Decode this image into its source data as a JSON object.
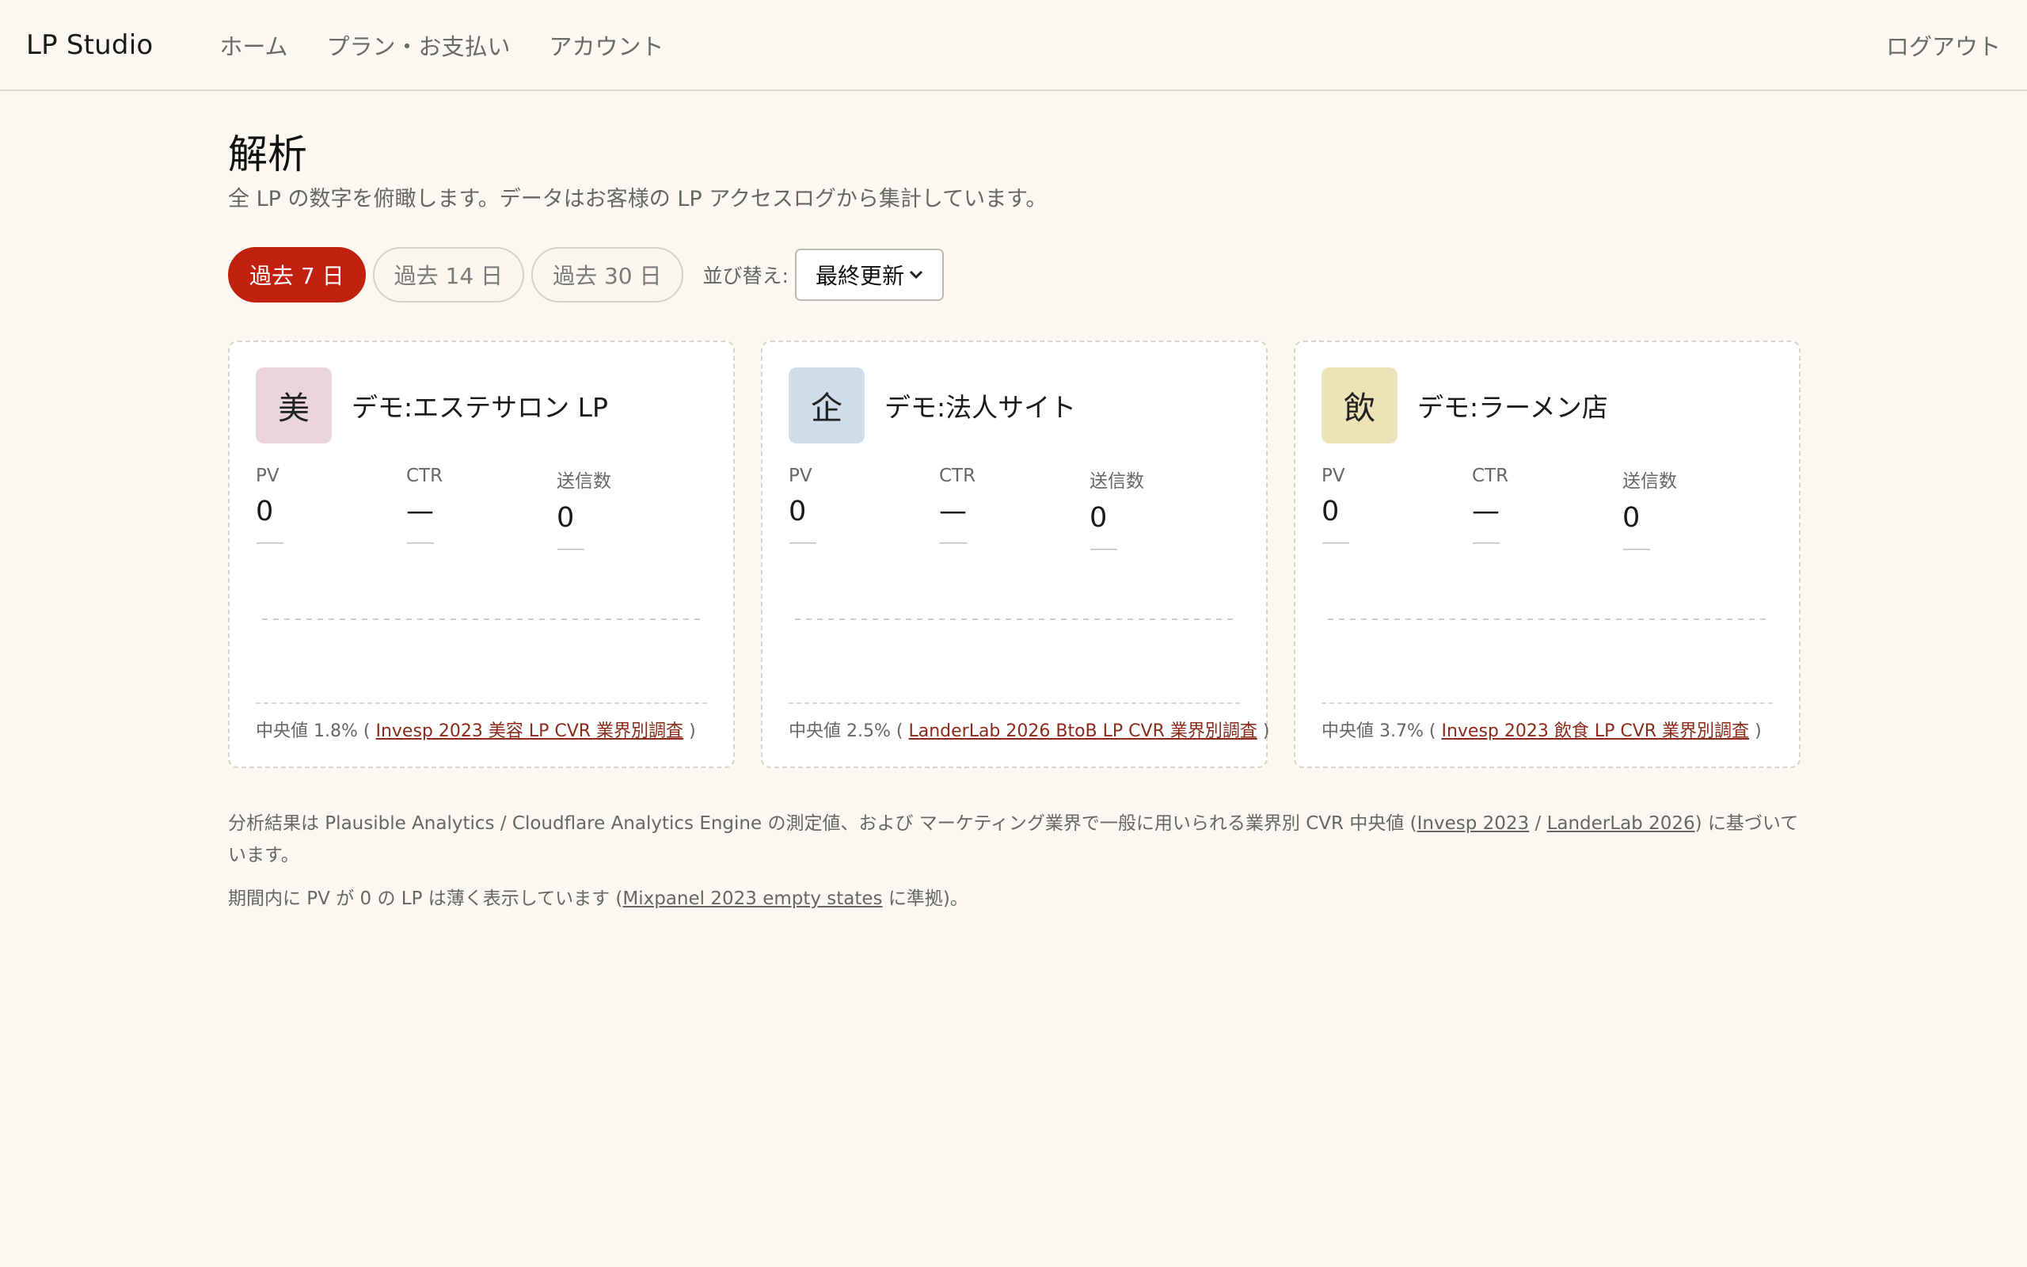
{
  "header": {
    "brand": "LP Studio",
    "nav": [
      "ホーム",
      "プラン・お支払い",
      "アカウント"
    ],
    "logout": "ログアウト"
  },
  "page": {
    "title": "解析",
    "subtitle": "全 LP の数字を俯瞰します。データはお客様の LP アクセスログから集計しています。"
  },
  "filters": {
    "ranges": [
      "過去 7 日",
      "過去 14 日",
      "過去 30 日"
    ],
    "active_range": "過去 7 日",
    "sort_label": "並び替え:",
    "sort_value": "最終更新"
  },
  "cards": [
    {
      "avatar": "美",
      "avatar_color": "#ead5de",
      "name": "デモ:エステサロン LP",
      "metrics": [
        {
          "label": "PV",
          "value": "0",
          "delta": "——"
        },
        {
          "label": "CTR",
          "value": "—",
          "delta": "——"
        },
        {
          "label": "送信数",
          "value": "0",
          "delta": "——"
        }
      ],
      "foot_prefix": "中央値 1.8% (",
      "foot_link": "Invesp 2023 美容 LP CVR 業界別調査",
      "foot_suffix": ")"
    },
    {
      "avatar": "企",
      "avatar_color": "#d0dcea",
      "name": "デモ:法人サイト",
      "metrics": [
        {
          "label": "PV",
          "value": "0",
          "delta": "——"
        },
        {
          "label": "CTR",
          "value": "—",
          "delta": "——"
        },
        {
          "label": "送信数",
          "value": "0",
          "delta": "——"
        }
      ],
      "foot_prefix": "中央値 2.5% (",
      "foot_link": "LanderLab 2026 BtoB LP CVR 業界別調査",
      "foot_suffix": ")"
    },
    {
      "avatar": "飲",
      "avatar_color": "#eee2b8",
      "name": "デモ:ラーメン店",
      "metrics": [
        {
          "label": "PV",
          "value": "0",
          "delta": "——"
        },
        {
          "label": "CTR",
          "value": "—",
          "delta": "——"
        },
        {
          "label": "送信数",
          "value": "0",
          "delta": "——"
        }
      ],
      "foot_prefix": "中央値 3.7% (",
      "foot_link": "Invesp 2023 飲食 LP CVR 業界別調査",
      "foot_suffix": ")"
    }
  ],
  "notes": {
    "line1_prefix": "分析結果は Plausible Analytics / Cloudflare Analytics Engine の測定値、および マーケティング業界で一般に用いられる業界別 CVR 中央値 (",
    "line1_link1": "Invesp 2023",
    "line1_sep": " / ",
    "line1_link2": "LanderLab 2026",
    "line1_suffix": ") に基づいています。",
    "line2_prefix": "期間内に PV が 0 の LP は薄く表示しています (",
    "line2_link": "Mixpanel 2023 empty states",
    "line2_suffix": " に準拠)。"
  }
}
